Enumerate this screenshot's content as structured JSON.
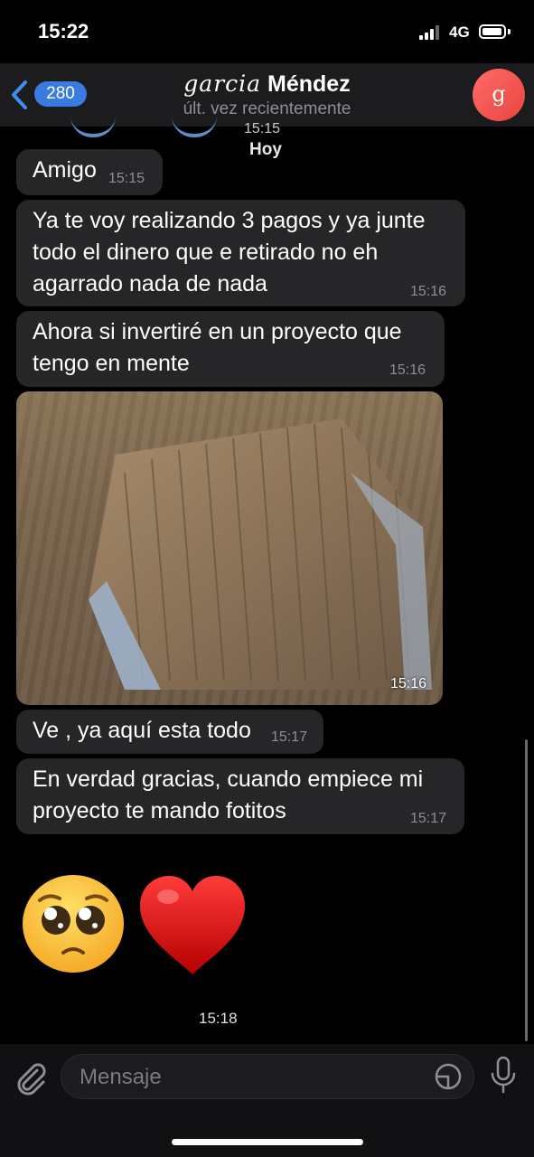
{
  "status_bar": {
    "time": "15:22",
    "network": "4G"
  },
  "header": {
    "back_count": "280",
    "title_script": "garcia",
    "title_name": "Méndez",
    "subtitle": "últ. vez recientemente",
    "avatar_letter": "g"
  },
  "chat": {
    "partial_time": "15:15",
    "date_separator": "Hoy",
    "messages": [
      {
        "text": "Amigo",
        "time": "15:15"
      },
      {
        "text": "Ya te voy realizando 3 pagos y ya junte\ntodo el dinero que e retirado no eh\nagarrado nada de nada",
        "time": "15:16"
      },
      {
        "text": "Ahora si invertiré en un proyecto que\ntengo en mente",
        "time": "15:16"
      },
      {
        "type": "photo",
        "time": "15:16"
      },
      {
        "text": "Ve , ya aquí esta todo",
        "time": "15:17"
      },
      {
        "text": "En verdad gracias, cuando empiece mi\nproyecto te mando fotitos",
        "time": "15:17"
      },
      {
        "type": "emoji",
        "emojis": [
          "pleading-face-icon",
          "red-heart-icon"
        ],
        "time": "15:18"
      }
    ]
  },
  "input": {
    "placeholder": "Mensaje"
  },
  "colors": {
    "accent": "#3a7be0",
    "bubble": "#262628",
    "avatar": "#e8453c"
  }
}
